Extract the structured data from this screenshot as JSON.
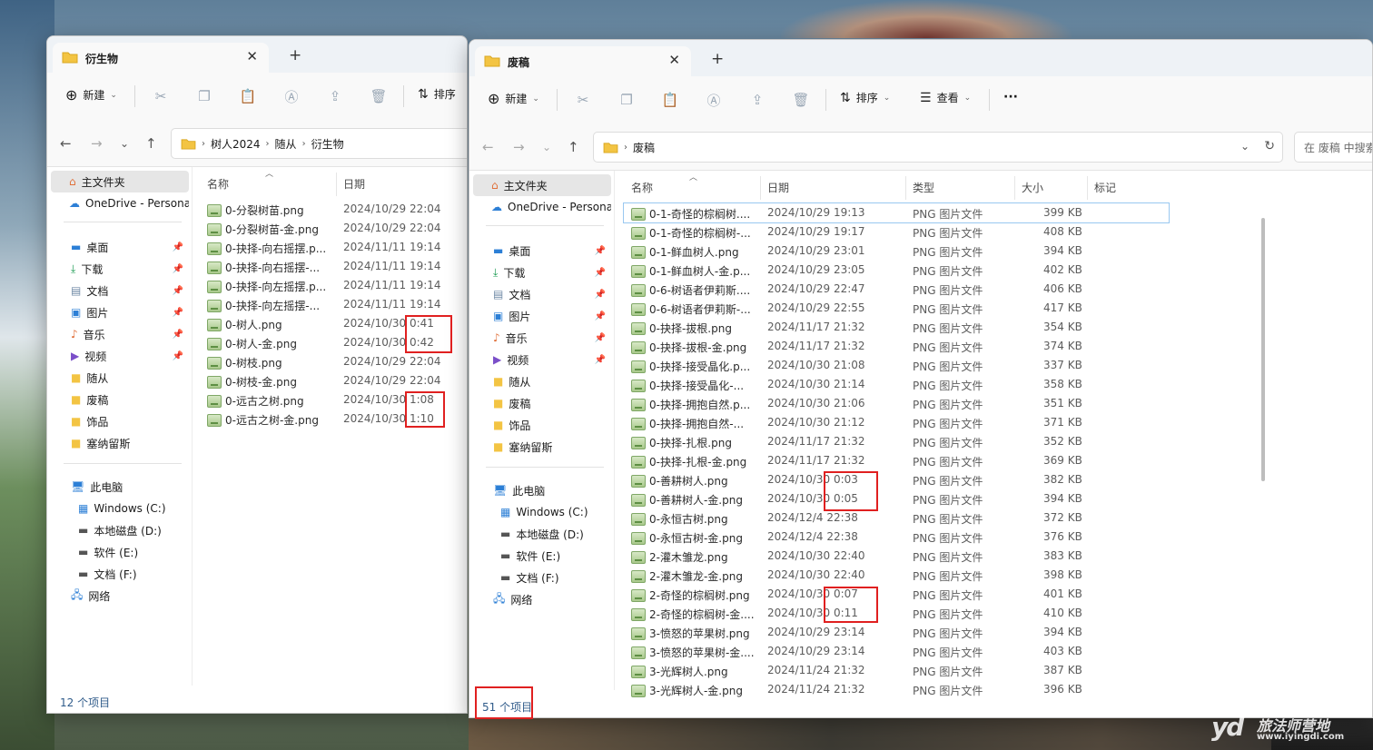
{
  "colors": {
    "accent": "#0067c0",
    "highlight_box": "#e02020",
    "folder": "#f3c443"
  },
  "window1": {
    "tab_title": "衍生物",
    "toolbar": {
      "new_label": "新建",
      "sort_label": "排序"
    },
    "breadcrumb": [
      "树人2024",
      "随从",
      "衍生物"
    ],
    "sidebar": {
      "home": "主文件夹",
      "onedrive": "OneDrive - Personal",
      "quick": [
        "桌面",
        "下载",
        "文档",
        "图片",
        "音乐",
        "视频",
        "随从",
        "废稿",
        "饰品",
        "塞纳留斯"
      ],
      "this_pc": "此电脑",
      "drives": [
        "Windows (C:)",
        "本地磁盘 (D:)",
        "软件 (E:)",
        "文档 (F:)"
      ],
      "network": "网络"
    },
    "columns": {
      "name": "名称",
      "date": "日期"
    },
    "files": [
      {
        "name": "0-分裂树苗.png",
        "date": "2024/10/29 22:04"
      },
      {
        "name": "0-分裂树苗-金.png",
        "date": "2024/10/29 22:04"
      },
      {
        "name": "0-抉择-向右摇摆.p...",
        "date": "2024/11/11 19:14"
      },
      {
        "name": "0-抉择-向右摇摆-...",
        "date": "2024/11/11 19:14"
      },
      {
        "name": "0-抉择-向左摇摆.p...",
        "date": "2024/11/11 19:14"
      },
      {
        "name": "0-抉择-向左摇摆-...",
        "date": "2024/11/11 19:14"
      },
      {
        "name": "0-树人.png",
        "date": "2024/10/30 0:41"
      },
      {
        "name": "0-树人-金.png",
        "date": "2024/10/30 0:42"
      },
      {
        "name": "0-树枝.png",
        "date": "2024/10/29 22:04"
      },
      {
        "name": "0-树枝-金.png",
        "date": "2024/10/29 22:04"
      },
      {
        "name": "0-远古之树.png",
        "date": "2024/10/30 1:08"
      },
      {
        "name": "0-远古之树-金.png",
        "date": "2024/10/30 1:10"
      }
    ],
    "status": "12 个项目"
  },
  "window2": {
    "tab_title": "废稿",
    "toolbar": {
      "new_label": "新建",
      "sort_label": "排序",
      "view_label": "查看",
      "more_label": "···"
    },
    "breadcrumb": [
      "废稿"
    ],
    "search_placeholder": "在 废稿 中搜索",
    "sidebar": {
      "home": "主文件夹",
      "onedrive": "OneDrive - Personal",
      "quick": [
        "桌面",
        "下载",
        "文档",
        "图片",
        "音乐",
        "视频",
        "随从",
        "废稿",
        "饰品",
        "塞纳留斯"
      ],
      "this_pc": "此电脑",
      "drives": [
        "Windows (C:)",
        "本地磁盘 (D:)",
        "软件 (E:)",
        "文档 (F:)"
      ],
      "network": "网络"
    },
    "columns": {
      "name": "名称",
      "date": "日期",
      "type": "类型",
      "size": "大小",
      "tag": "标记"
    },
    "files": [
      {
        "name": "0-1-奇怪的棕榈树....",
        "date": "2024/10/29 19:13",
        "type": "PNG 图片文件",
        "size": "399 KB"
      },
      {
        "name": "0-1-奇怪的棕榈树-...",
        "date": "2024/10/29 19:17",
        "type": "PNG 图片文件",
        "size": "408 KB"
      },
      {
        "name": "0-1-鲜血树人.png",
        "date": "2024/10/29 23:01",
        "type": "PNG 图片文件",
        "size": "394 KB"
      },
      {
        "name": "0-1-鲜血树人-金.p...",
        "date": "2024/10/29 23:05",
        "type": "PNG 图片文件",
        "size": "402 KB"
      },
      {
        "name": "0-6-树语者伊莉斯....",
        "date": "2024/10/29 22:47",
        "type": "PNG 图片文件",
        "size": "406 KB"
      },
      {
        "name": "0-6-树语者伊莉斯-...",
        "date": "2024/10/29 22:55",
        "type": "PNG 图片文件",
        "size": "417 KB"
      },
      {
        "name": "0-抉择-拔根.png",
        "date": "2024/11/17 21:32",
        "type": "PNG 图片文件",
        "size": "354 KB"
      },
      {
        "name": "0-抉择-拔根-金.png",
        "date": "2024/11/17 21:32",
        "type": "PNG 图片文件",
        "size": "374 KB"
      },
      {
        "name": "0-抉择-接受晶化.p...",
        "date": "2024/10/30 21:08",
        "type": "PNG 图片文件",
        "size": "337 KB"
      },
      {
        "name": "0-抉择-接受晶化-...",
        "date": "2024/10/30 21:14",
        "type": "PNG 图片文件",
        "size": "358 KB"
      },
      {
        "name": "0-抉择-拥抱自然.p...",
        "date": "2024/10/30 21:06",
        "type": "PNG 图片文件",
        "size": "351 KB"
      },
      {
        "name": "0-抉择-拥抱自然-...",
        "date": "2024/10/30 21:12",
        "type": "PNG 图片文件",
        "size": "371 KB"
      },
      {
        "name": "0-抉择-扎根.png",
        "date": "2024/11/17 21:32",
        "type": "PNG 图片文件",
        "size": "352 KB"
      },
      {
        "name": "0-抉择-扎根-金.png",
        "date": "2024/11/17 21:32",
        "type": "PNG 图片文件",
        "size": "369 KB"
      },
      {
        "name": "0-善耕树人.png",
        "date": "2024/10/30 0:03",
        "type": "PNG 图片文件",
        "size": "382 KB"
      },
      {
        "name": "0-善耕树人-金.png",
        "date": "2024/10/30 0:05",
        "type": "PNG 图片文件",
        "size": "394 KB"
      },
      {
        "name": "0-永恒古树.png",
        "date": "2024/12/4 22:38",
        "type": "PNG 图片文件",
        "size": "372 KB"
      },
      {
        "name": "0-永恒古树-金.png",
        "date": "2024/12/4 22:38",
        "type": "PNG 图片文件",
        "size": "376 KB"
      },
      {
        "name": "2-灌木雏龙.png",
        "date": "2024/10/30 22:40",
        "type": "PNG 图片文件",
        "size": "383 KB"
      },
      {
        "name": "2-灌木雏龙-金.png",
        "date": "2024/10/30 22:40",
        "type": "PNG 图片文件",
        "size": "398 KB"
      },
      {
        "name": "2-奇怪的棕榈树.png",
        "date": "2024/10/30 0:07",
        "type": "PNG 图片文件",
        "size": "401 KB"
      },
      {
        "name": "2-奇怪的棕榈树-金....",
        "date": "2024/10/30 0:11",
        "type": "PNG 图片文件",
        "size": "410 KB"
      },
      {
        "name": "3-愤怒的苹果树.png",
        "date": "2024/10/29 23:14",
        "type": "PNG 图片文件",
        "size": "394 KB"
      },
      {
        "name": "3-愤怒的苹果树-金....",
        "date": "2024/10/29 23:14",
        "type": "PNG 图片文件",
        "size": "403 KB"
      },
      {
        "name": "3-光辉树人.png",
        "date": "2024/11/24 21:32",
        "type": "PNG 图片文件",
        "size": "387 KB"
      },
      {
        "name": "3-光辉树人-金.png",
        "date": "2024/11/24 21:32",
        "type": "PNG 图片文件",
        "size": "396 KB"
      }
    ],
    "status": "51 个项目"
  },
  "watermark": {
    "logo": "yd",
    "brand": "旅法师营地",
    "url": "www.iyingdi.com"
  }
}
